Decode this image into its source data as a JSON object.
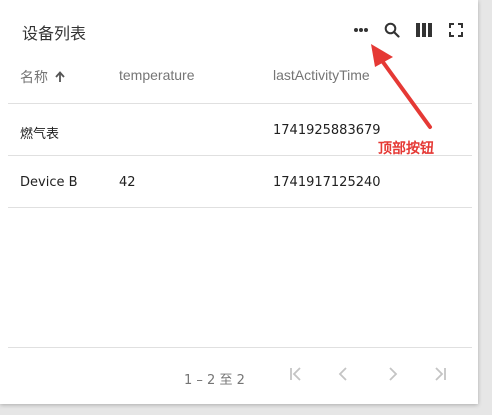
{
  "header": {
    "title": "设备列表",
    "icons": [
      "more-horiz-icon",
      "search-icon",
      "columns-icon",
      "fullscreen-icon"
    ]
  },
  "table": {
    "columns": [
      {
        "label": "名称",
        "sort": "ascending"
      },
      {
        "label": "temperature"
      },
      {
        "label": "lastActivityTime"
      }
    ],
    "rows": [
      {
        "name": "燃气表",
        "temperature": "",
        "lastActivityTime": "1741925883679"
      },
      {
        "name": "Device B",
        "temperature": "42",
        "lastActivityTime": "1741917125240"
      }
    ]
  },
  "pagination": {
    "range_label": "1 – 2 至 2"
  },
  "annotation": {
    "label": "顶部按钮",
    "color": "#e53935"
  }
}
